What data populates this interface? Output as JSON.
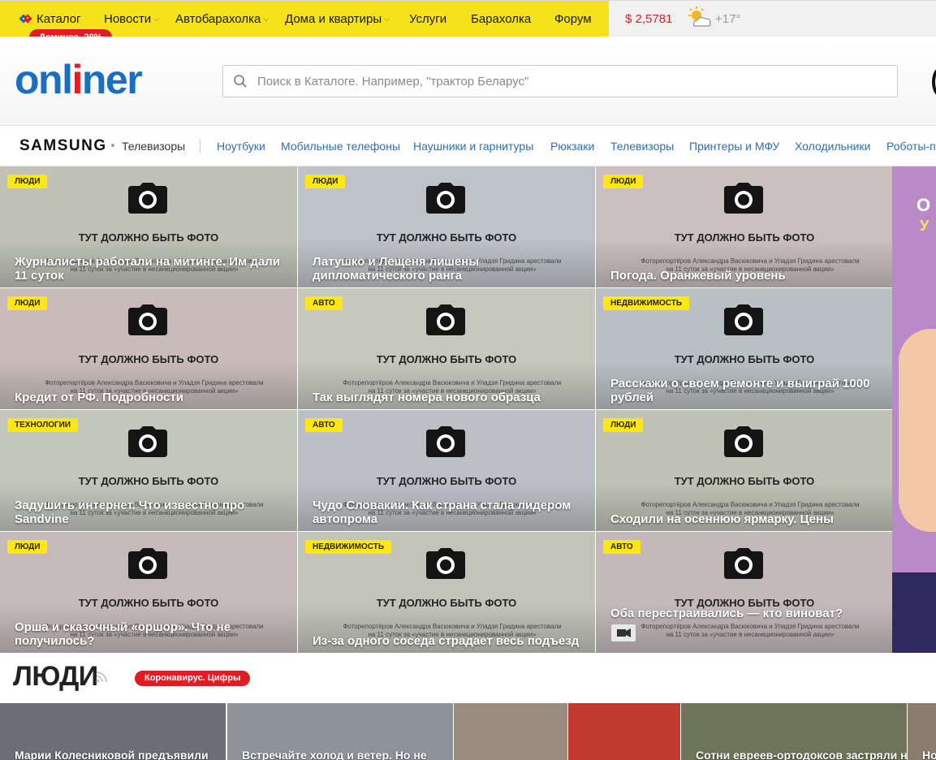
{
  "topnav": {
    "items": [
      {
        "label": "Каталог",
        "dropdown": false
      },
      {
        "label": "Новости",
        "dropdown": true
      },
      {
        "label": "Автобарахолка",
        "dropdown": true
      },
      {
        "label": "Дома и квартиры",
        "dropdown": true
      },
      {
        "label": "Услуги",
        "dropdown": false
      },
      {
        "label": "Барахолка",
        "dropdown": false
      },
      {
        "label": "Форум",
        "dropdown": false
      }
    ],
    "promo": "Доминос -20%",
    "currency": "$ 2,5781",
    "temperature": "+17°",
    "colors": {
      "bar": "#f5e21b",
      "promo": "#e31b23",
      "currency": "#d3232a"
    }
  },
  "header": {
    "logo_part1": "onl",
    "logo_accent": "i",
    "logo_part2": "ner",
    "search_placeholder": "Поиск в Каталоге. Например, \"трактор Беларус\"",
    "search_value": ""
  },
  "sponsor": {
    "brand": "SAMSUNG",
    "label": "Телевизоры",
    "links": [
      "Ноутбуки",
      "Мобильные телефоны",
      "Наушники и гарнитуры",
      "Рюкзаки",
      "Телевизоры",
      "Принтеры и МФУ",
      "Холодильники",
      "Роботы-п"
    ]
  },
  "placeholder": {
    "title": "ТУТ ДОЛЖНО БЫТЬ ФОТО",
    "caption_line1": "Фоторепортёров Александра Васюковича и Уладзя Гридина арестовали",
    "caption_line2": "на 11 суток за «участие в несанкционированной акции»"
  },
  "news": [
    {
      "tag": "ЛЮДИ",
      "headline": "Журналисты работали на митинге. Им дали 11 суток",
      "bg": "#bfc2b5",
      "video": false
    },
    {
      "tag": "ЛЮДИ",
      "headline": "Латушко и Лещеня лишены дипломатического ранга",
      "bg": "#bdc3c8",
      "video": false
    },
    {
      "tag": "ЛЮДИ",
      "headline": "Погода. Оранжевый уровень",
      "bg": "#cbbfbf",
      "video": false
    },
    {
      "tag": "ЛЮДИ",
      "headline": "Кредит от РФ. Подробности",
      "bg": "#c9bbb9",
      "video": false
    },
    {
      "tag": "АВТО",
      "headline": "Так выглядят номера нового образца",
      "bg": "#c6c8bc",
      "video": false
    },
    {
      "tag": "НЕДВИЖИМОСТЬ",
      "headline": "Расскажи о своем ремонте и выиграй 1000 рублей",
      "bg": "#b9c0c4",
      "video": false
    },
    {
      "tag": "ТЕХНОЛОГИИ",
      "headline": "Задушить интернет. Что известно про Sandvine",
      "bg": "#c2c6bb",
      "video": false
    },
    {
      "tag": "АВТО",
      "headline": "Чудо Словакии. Как страна стала лидером автопрома",
      "bg": "#bcc0c6",
      "video": false
    },
    {
      "tag": "ЛЮДИ",
      "headline": "Сходили на осеннюю ярмарку. Цены",
      "bg": "#bfc2b4",
      "video": false
    },
    {
      "tag": "ЛЮДИ",
      "headline": "Орша и сказочный «оршор». Что не получилось?",
      "bg": "#c6b9b9",
      "video": false
    },
    {
      "tag": "НЕДВИЖИМОСТЬ",
      "headline": "Из-за одного соседа страдает весь подъезд",
      "bg": "#c2c4b8",
      "video": false
    },
    {
      "tag": "АВТО",
      "headline": "Оба перестраивались — кто виноват?",
      "bg": "#c4b8bb",
      "video": true
    }
  ],
  "ad": {
    "line1": "О",
    "line2": "У"
  },
  "section": {
    "title": "ЛЮДИ",
    "badge": "Коронавирус. Цифры"
  },
  "section_news": [
    {
      "headline": "Марии Колесниковой предъявили",
      "bg": "#6b6e74"
    },
    {
      "headline": "Встречайте холод и ветер. Но не",
      "bg": "#8c949a"
    },
    {
      "headline": "",
      "bg": "#9a8d80"
    },
    {
      "headline": "",
      "bg": "#c23a2f"
    },
    {
      "headline": "Сотни евреев-ортодоксов застряли на",
      "bg": "#6e7457"
    },
    {
      "headline": "Но",
      "bg": "#8a7d70"
    }
  ]
}
